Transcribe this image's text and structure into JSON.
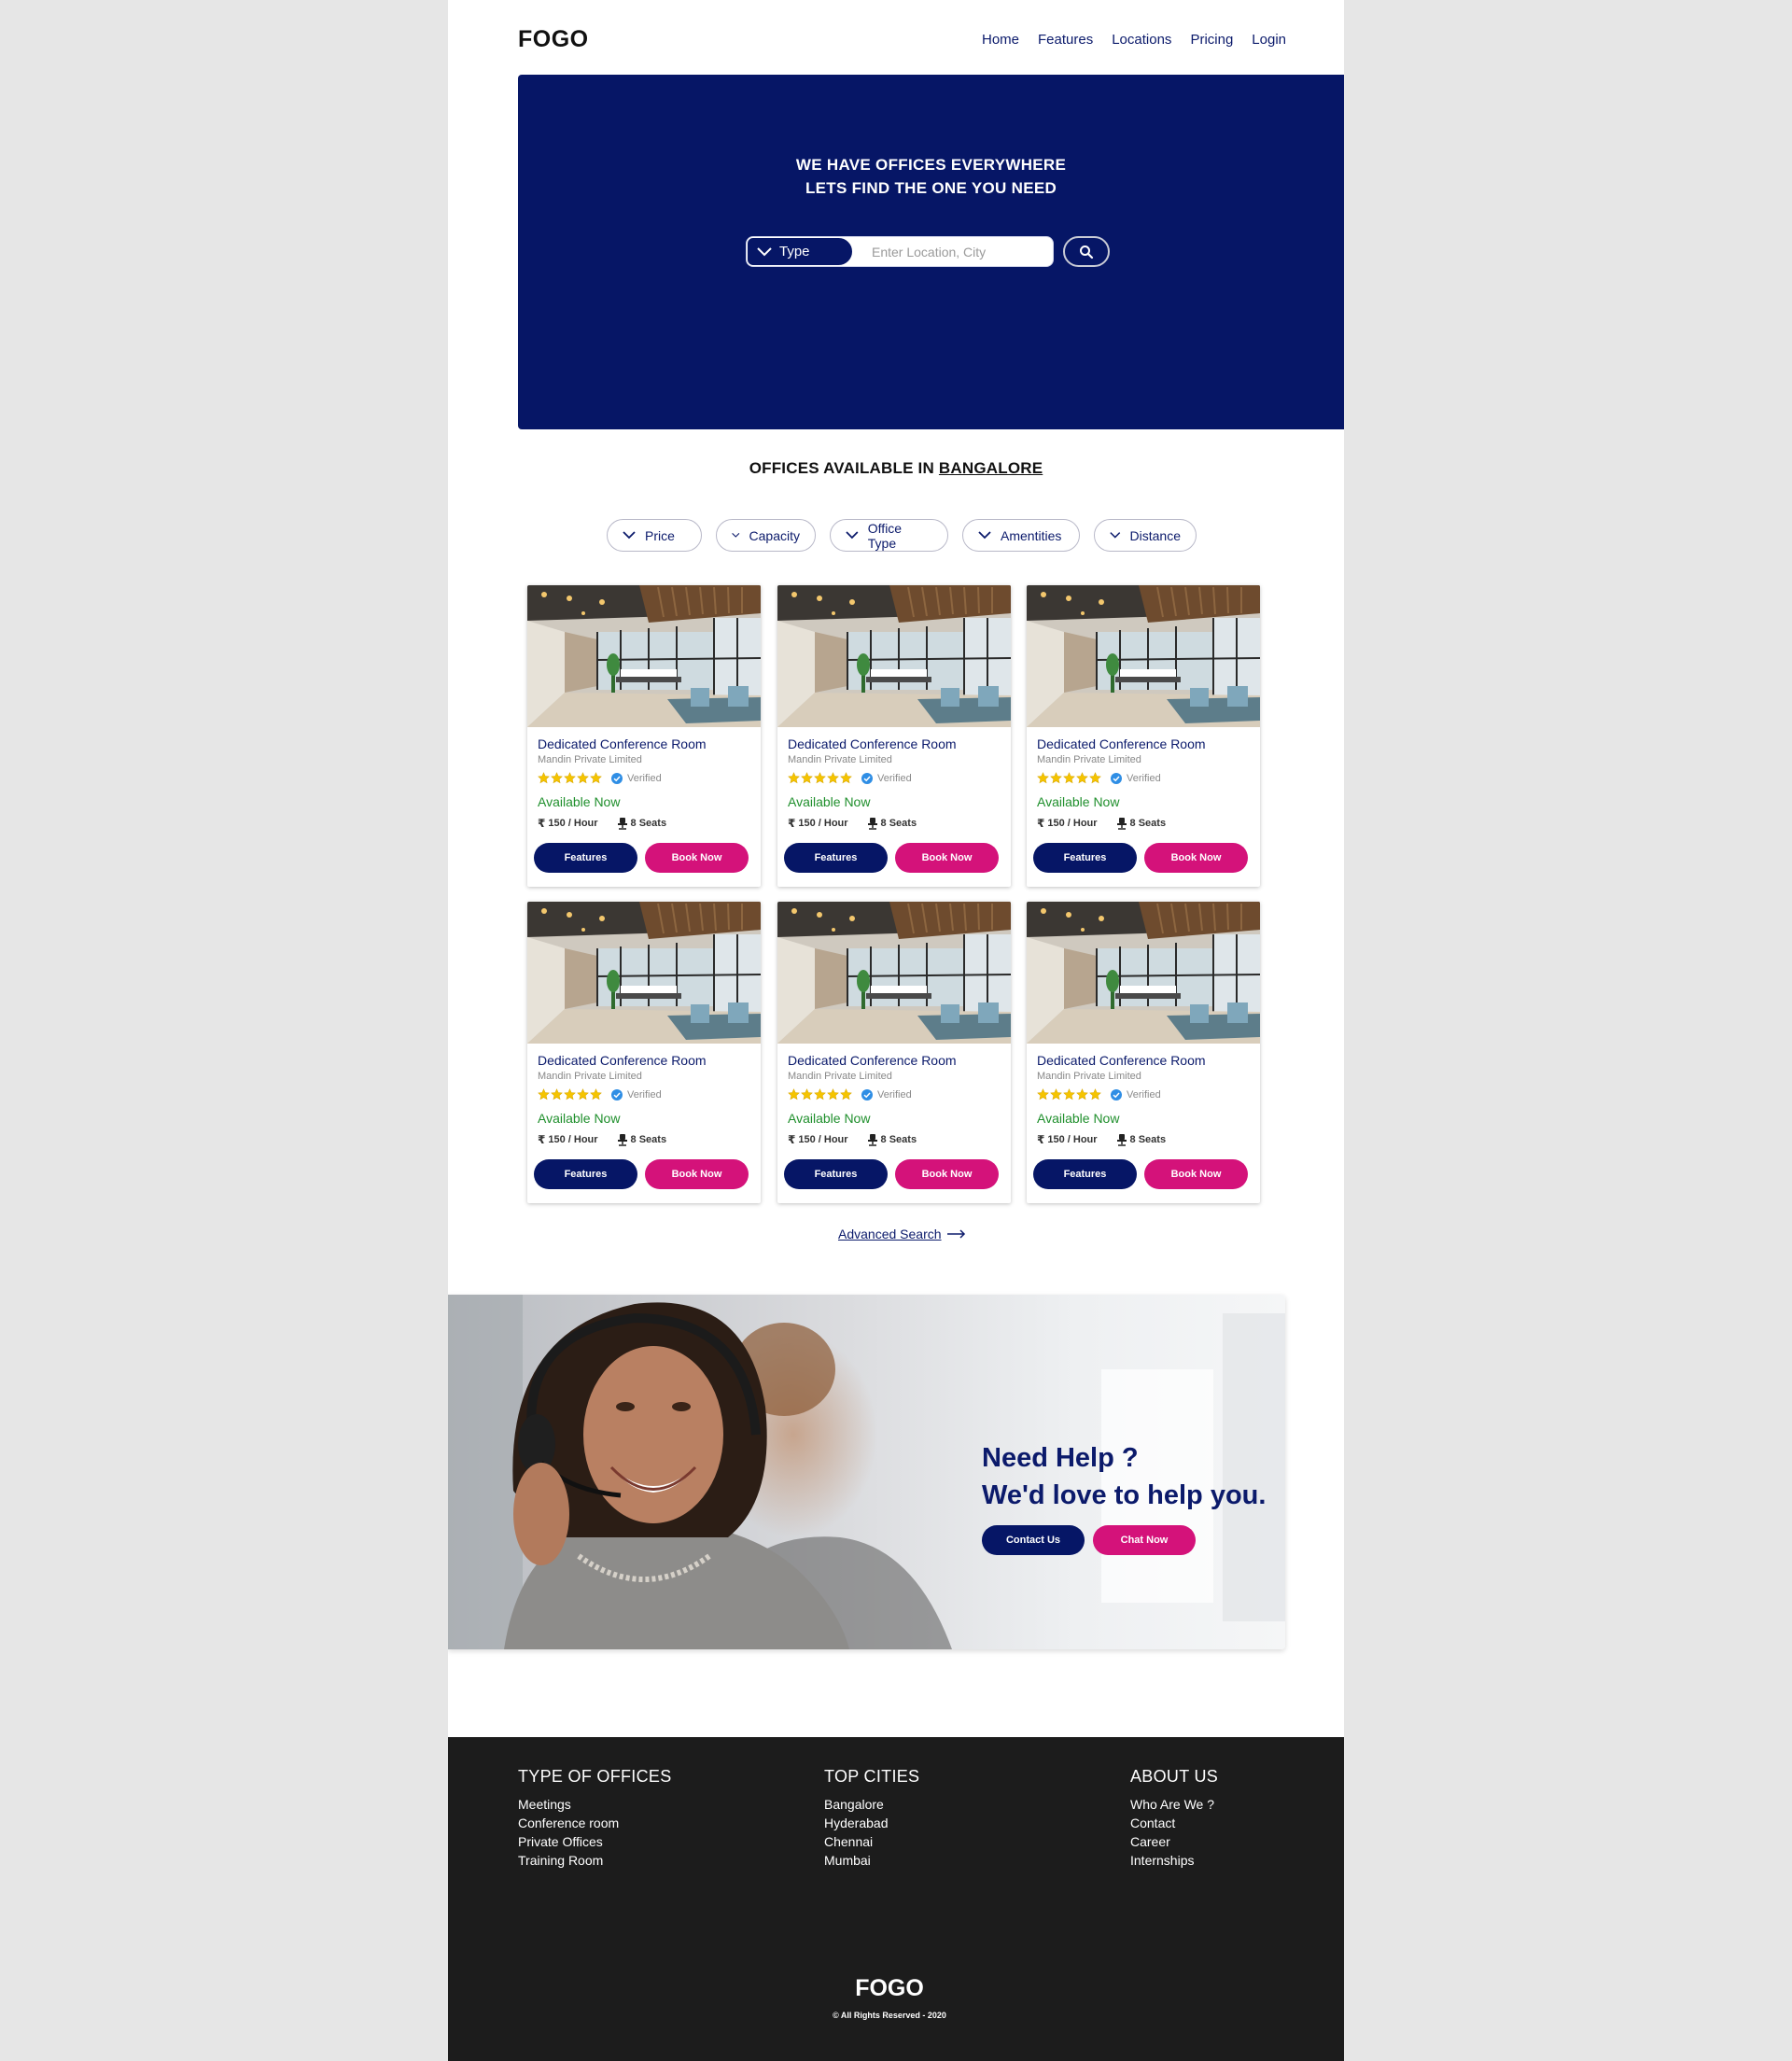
{
  "header": {
    "logo": "FOGO",
    "nav": [
      "Home",
      "Features",
      "Locations",
      "Pricing",
      "Login"
    ]
  },
  "hero": {
    "title_line1": "WE HAVE OFFICES EVERYWHERE",
    "title_line2": "LETS FIND THE ONE YOU NEED",
    "type_label": "Type",
    "location_placeholder": "Enter Location, City"
  },
  "offices": {
    "title_prefix": "OFFICES AVAILABLE IN",
    "city": "BANGALORE"
  },
  "filters": [
    "Price",
    "Capacity",
    "Office Type",
    "Amentities",
    "Distance"
  ],
  "cards": [
    {
      "title": "Dedicated Conference Room",
      "company": "Mandin Private Limited",
      "rating": 5,
      "verified": "Verified",
      "status": "Available Now",
      "price": "150 / Hour",
      "seats": "8 Seats",
      "features_label": "Features",
      "book_label": "Book Now"
    },
    {
      "title": "Dedicated Conference Room",
      "company": "Mandin Private Limited",
      "rating": 5,
      "verified": "Verified",
      "status": "Available Now",
      "price": "150 / Hour",
      "seats": "8 Seats",
      "features_label": "Features",
      "book_label": "Book Now"
    },
    {
      "title": "Dedicated Conference Room",
      "company": "Mandin Private Limited",
      "rating": 5,
      "verified": "Verified",
      "status": "Available Now",
      "price": "150 / Hour",
      "seats": "8 Seats",
      "features_label": "Features",
      "book_label": "Book Now"
    },
    {
      "title": "Dedicated Conference Room",
      "company": "Mandin Private Limited",
      "rating": 5,
      "verified": "Verified",
      "status": "Available Now",
      "price": "150 / Hour",
      "seats": "8 Seats",
      "features_label": "Features",
      "book_label": "Book Now"
    },
    {
      "title": "Dedicated Conference Room",
      "company": "Mandin Private Limited",
      "rating": 5,
      "verified": "Verified",
      "status": "Available Now",
      "price": "150 / Hour",
      "seats": "8 Seats",
      "features_label": "Features",
      "book_label": "Book Now"
    },
    {
      "title": "Dedicated Conference Room",
      "company": "Mandin Private Limited",
      "rating": 5,
      "verified": "Verified",
      "status": "Available Now",
      "price": "150 / Hour",
      "seats": "8 Seats",
      "features_label": "Features",
      "book_label": "Book Now"
    }
  ],
  "advanced_search": "Advanced Search",
  "help": {
    "line1": "Need Help ?",
    "line2": "We'd love to help you.",
    "contact_label": "Contact Us",
    "chat_label": "Chat Now"
  },
  "footer": {
    "columns": [
      {
        "title": "TYPE OF OFFICES",
        "links": [
          "Meetings",
          "Conference room",
          "Private Offices",
          "Training Room"
        ]
      },
      {
        "title": "TOP CITIES",
        "links": [
          "Bangalore",
          "Hyderabad",
          "Chennai",
          "Mumbai"
        ]
      },
      {
        "title": "ABOUT US",
        "links": [
          "Who Are We ?",
          "Contact",
          "Career",
          "Internships"
        ]
      }
    ],
    "logo": "FOGO",
    "copyright": "© All Rights Reserved - 2020"
  },
  "colors": {
    "navy": "#061666",
    "magenta": "#d4127a",
    "available_green": "#1f8f2c",
    "star_yellow": "#f5c400",
    "footer_bg": "#1c1c1c"
  }
}
